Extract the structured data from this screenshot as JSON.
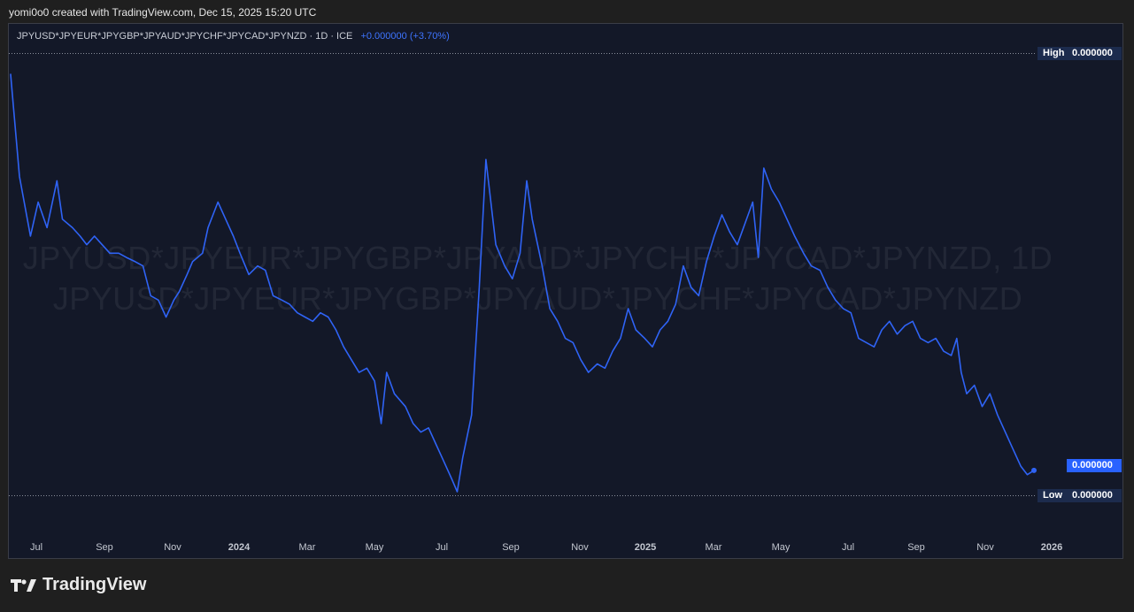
{
  "header": {
    "attribution": "yomi0o0 created with TradingView.com, Dec 15, 2025 15:20 UTC"
  },
  "legend": {
    "symbol": "JPYUSD*JPYEUR*JPYGBP*JPYAUD*JPYCHF*JPYCAD*JPYNZD · 1D · ICE",
    "change": "+0.000000 (+3.70%)"
  },
  "watermark": {
    "line1": "JPYUSD*JPYEUR*JPYGBP*JPYAUD*JPYCHF*JPYCAD*JPYNZD, 1D",
    "line2": "JPYUSD*JPYEUR*JPYGBP*JPYAUD*JPYCHF*JPYCAD*JPYNZD"
  },
  "markers": {
    "high_label": "High",
    "high_value": "0.000000",
    "low_label": "Low",
    "low_value": "0.000000",
    "last_value": "0.000000"
  },
  "brand": {
    "name": "TradingView",
    "logo_icon": "tradingview-logo-icon"
  },
  "colors": {
    "line": "#2f63f5",
    "background": "#131828",
    "accent": "#2962ff"
  },
  "chart_data": {
    "type": "line",
    "title": "",
    "xlabel": "",
    "ylabel": "",
    "x_tick_labels": [
      "Jul",
      "Sep",
      "Nov",
      "2024",
      "Mar",
      "May",
      "Jul",
      "Sep",
      "Nov",
      "2025",
      "Mar",
      "May",
      "Jul",
      "Sep",
      "Nov",
      "2026"
    ],
    "grid": false,
    "series": [
      {
        "x": [
          "2023-06-01",
          "2023-06-09",
          "2023-06-19",
          "2023-06-26",
          "2023-07-04",
          "2023-07-13",
          "2023-07-18",
          "2023-07-27",
          "2023-08-03",
          "2023-08-09",
          "2023-08-16",
          "2023-08-23",
          "2023-08-30",
          "2023-09-07",
          "2023-09-14",
          "2023-09-22",
          "2023-09-29",
          "2023-10-06",
          "2023-10-13",
          "2023-10-20",
          "2023-10-27",
          "2023-11-01",
          "2023-11-08",
          "2023-11-13",
          "2023-11-22",
          "2023-11-27",
          "2023-12-06",
          "2023-12-13",
          "2023-12-20",
          "2023-12-26",
          "2024-01-03",
          "2024-01-11",
          "2024-01-18",
          "2024-01-25",
          "2024-02-02",
          "2024-02-09",
          "2024-02-16",
          "2024-02-23",
          "2024-03-01",
          "2024-03-08",
          "2024-03-15",
          "2024-03-22",
          "2024-03-29",
          "2024-04-05",
          "2024-04-12",
          "2024-04-19",
          "2024-04-26",
          "2024-05-02",
          "2024-05-07",
          "2024-05-14",
          "2024-05-24",
          "2024-05-31",
          "2024-06-07",
          "2024-06-14",
          "2024-06-21",
          "2024-06-28",
          "2024-07-05",
          "2024-07-10",
          "2024-07-15",
          "2024-07-23",
          "2024-07-30",
          "2024-08-05",
          "2024-08-14",
          "2024-08-22",
          "2024-08-29",
          "2024-09-05",
          "2024-09-11",
          "2024-09-16",
          "2024-09-25",
          "2024-10-02",
          "2024-10-09",
          "2024-10-16",
          "2024-10-23",
          "2024-10-30",
          "2024-11-06",
          "2024-11-14",
          "2024-11-21",
          "2024-11-28",
          "2024-12-05",
          "2024-12-12",
          "2024-12-19",
          "2024-12-27",
          "2025-01-03",
          "2025-01-10",
          "2025-01-17",
          "2025-01-24",
          "2025-01-31",
          "2025-02-07",
          "2025-02-14",
          "2025-02-21",
          "2025-02-28",
          "2025-03-07",
          "2025-03-14",
          "2025-03-21",
          "2025-03-28",
          "2025-04-04",
          "2025-04-09",
          "2025-04-14",
          "2025-04-21",
          "2025-04-28",
          "2025-05-05",
          "2025-05-12",
          "2025-05-20",
          "2025-05-27",
          "2025-06-04",
          "2025-06-11",
          "2025-06-18",
          "2025-06-25",
          "2025-07-02",
          "2025-07-09",
          "2025-07-16",
          "2025-07-23",
          "2025-07-30",
          "2025-08-06",
          "2025-08-13",
          "2025-08-20",
          "2025-08-27",
          "2025-09-03",
          "2025-09-10",
          "2025-09-17",
          "2025-09-24",
          "2025-10-01",
          "2025-10-06",
          "2025-10-10",
          "2025-10-15",
          "2025-10-22",
          "2025-10-29",
          "2025-11-05",
          "2025-11-12",
          "2025-11-19",
          "2025-11-26",
          "2025-12-03",
          "2025-12-09",
          "2025-12-15"
        ],
        "y": [
          100,
          76,
          62,
          70,
          64,
          75,
          66,
          64,
          62,
          60,
          62,
          60,
          58,
          58,
          57,
          56,
          55,
          48,
          47,
          43,
          47,
          49,
          53,
          56,
          58,
          64,
          70,
          66,
          62,
          58,
          53,
          55,
          54,
          48,
          47,
          46,
          44,
          43,
          42,
          44,
          43,
          40,
          36,
          33,
          30,
          31,
          28,
          18,
          30,
          25,
          22,
          18,
          16,
          17,
          13,
          9,
          5,
          2,
          10,
          20,
          50,
          80,
          60,
          55,
          52,
          58,
          75,
          66,
          55,
          45,
          42,
          38,
          37,
          33,
          30,
          32,
          31,
          35,
          38,
          45,
          40,
          38,
          36,
          40,
          42,
          46,
          55,
          50,
          48,
          56,
          62,
          67,
          63,
          60,
          65,
          70,
          57,
          78,
          73,
          70,
          66,
          62,
          58,
          55,
          54,
          50,
          47,
          45,
          44,
          38,
          37,
          36,
          40,
          42,
          39,
          41,
          42,
          38,
          37,
          38,
          35,
          34,
          38,
          30,
          25,
          27,
          22,
          25,
          20,
          16,
          12,
          8,
          6,
          7
        ]
      }
    ]
  }
}
